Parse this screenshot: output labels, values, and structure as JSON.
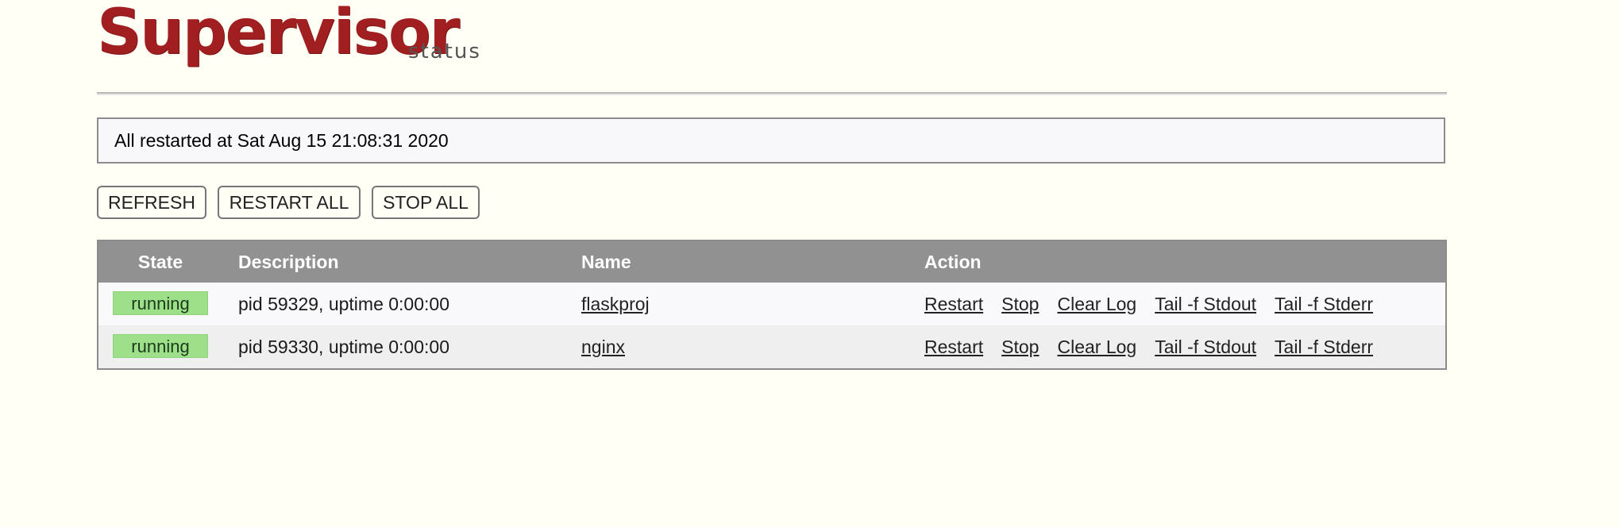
{
  "header": {
    "logo_text": "Supervisor",
    "logo_subtitle": "status"
  },
  "status_message": "All restarted at Sat Aug 15 21:08:31 2020",
  "buttons": {
    "refresh": "REFRESH",
    "restart_all": "RESTART ALL",
    "stop_all": "STOP ALL"
  },
  "table": {
    "headers": {
      "state": "State",
      "description": "Description",
      "name": "Name",
      "action": "Action"
    },
    "rows": [
      {
        "state": "running",
        "description": "pid 59329, uptime 0:00:00",
        "name": "flaskproj",
        "actions": [
          "Restart",
          "Stop",
          "Clear Log",
          "Tail -f Stdout",
          "Tail -f Stderr"
        ]
      },
      {
        "state": "running",
        "description": "pid 59330, uptime 0:00:00",
        "name": "nginx",
        "actions": [
          "Restart",
          "Stop",
          "Clear Log",
          "Tail -f Stdout",
          "Tail -f Stderr"
        ]
      }
    ]
  },
  "colors": {
    "logo": "#a11f20",
    "running_badge": "#9ee08a",
    "table_header": "#919191",
    "background": "#fffff6"
  }
}
